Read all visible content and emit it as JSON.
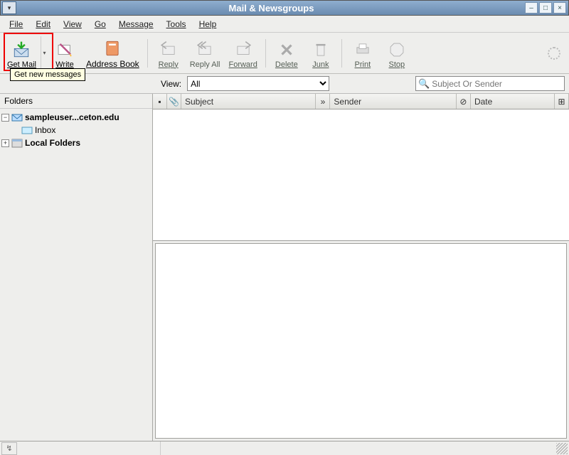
{
  "window": {
    "title": "Mail & Newsgroups"
  },
  "menu": {
    "file": "File",
    "edit": "Edit",
    "view": "View",
    "go": "Go",
    "message": "Message",
    "tools": "Tools",
    "help": "Help"
  },
  "toolbar": {
    "get_mail": "Get Mail",
    "write": "Write",
    "address": "Address Book",
    "reply": "Reply",
    "reply_all": "Reply All",
    "forward": "Forward",
    "delete": "Delete",
    "junk": "Junk",
    "print": "Print",
    "stop": "Stop"
  },
  "tooltip": "Get new messages",
  "filter": {
    "view_label": "View:",
    "view_value": "All",
    "search_placeholder": "Subject Or Sender"
  },
  "sidebar": {
    "header": "Folders",
    "account": "sampleuser...ceton.edu",
    "inbox": "Inbox",
    "local": "Local Folders"
  },
  "columns": {
    "subject": "Subject",
    "sender": "Sender",
    "date": "Date"
  }
}
